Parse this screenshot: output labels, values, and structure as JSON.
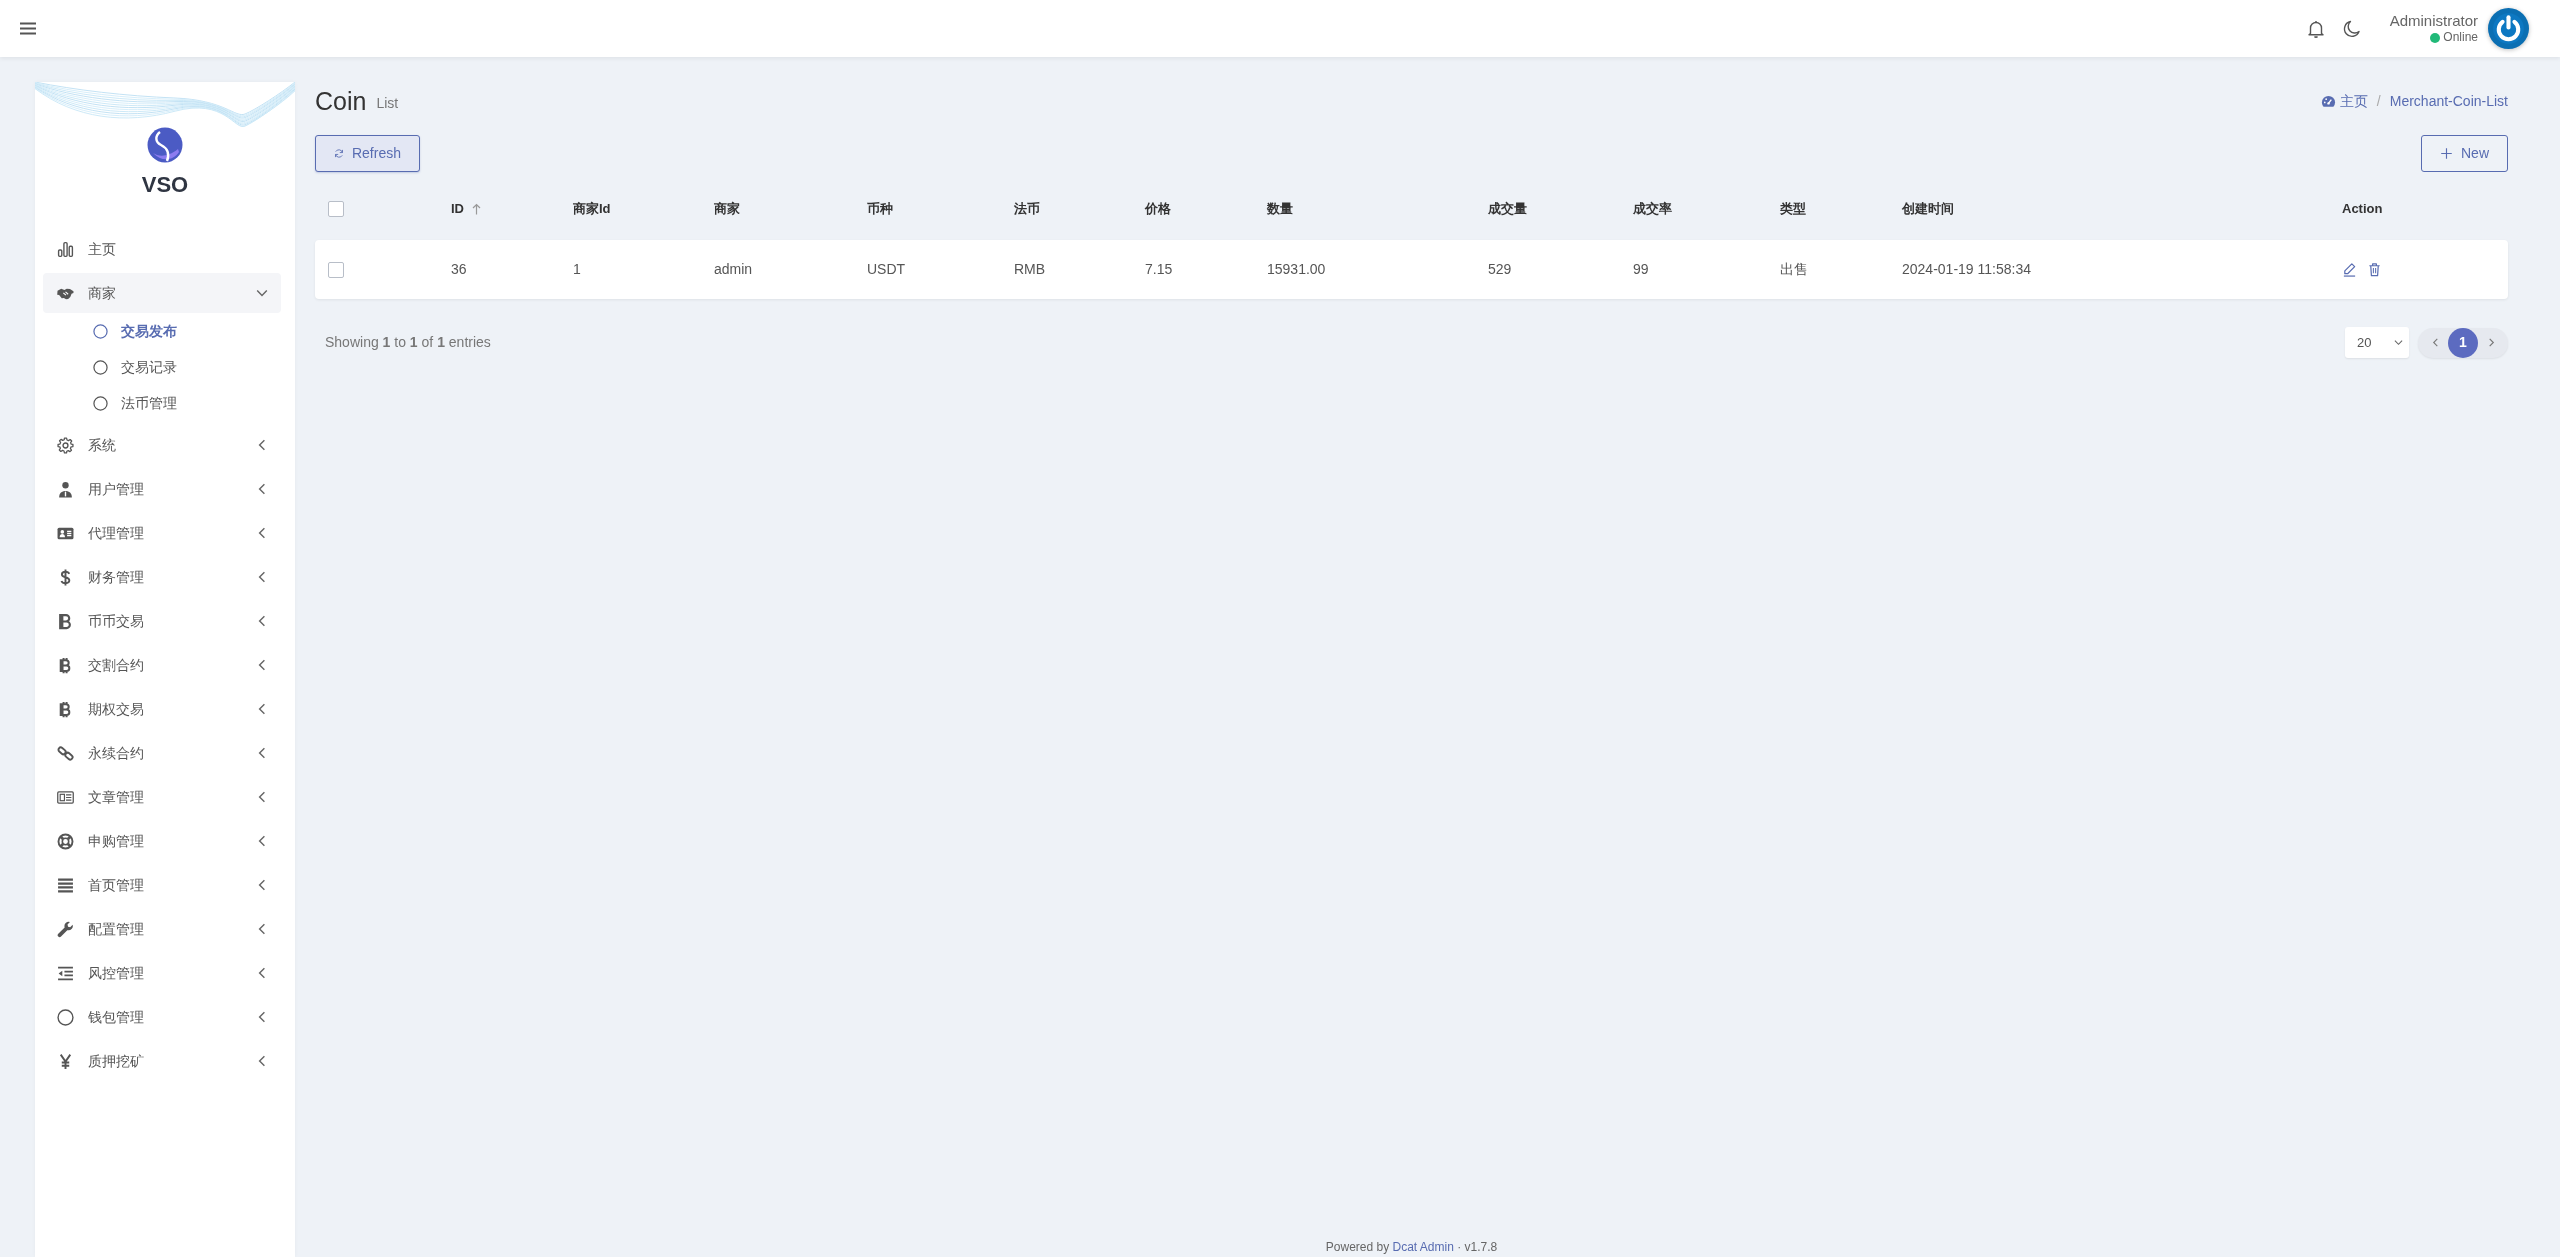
{
  "topbar": {
    "user": {
      "name": "Administrator",
      "status": "Online"
    }
  },
  "sidebar": {
    "brand": "VSO",
    "items": [
      {
        "label": "主页",
        "kind": "link",
        "selected": false
      },
      {
        "label": "商家",
        "kind": "group",
        "expanded": true,
        "selected": false,
        "children": [
          {
            "label": "交易发布",
            "selected": true
          },
          {
            "label": "交易记录",
            "selected": false
          },
          {
            "label": "法币管理",
            "selected": false
          }
        ]
      },
      {
        "label": "系统",
        "kind": "group",
        "expanded": false,
        "selected": false
      },
      {
        "label": "用户管理",
        "kind": "group",
        "expanded": false,
        "selected": false
      },
      {
        "label": "代理管理",
        "kind": "group",
        "expanded": false,
        "selected": false
      },
      {
        "label": "财务管理",
        "kind": "group",
        "expanded": false,
        "selected": false
      },
      {
        "label": "币币交易",
        "kind": "group",
        "expanded": false,
        "selected": false
      },
      {
        "label": "交割合约",
        "kind": "group",
        "expanded": false,
        "selected": false
      },
      {
        "label": "期权交易",
        "kind": "group",
        "expanded": false,
        "selected": false
      },
      {
        "label": "永续合约",
        "kind": "group",
        "expanded": false,
        "selected": false
      },
      {
        "label": "文章管理",
        "kind": "group",
        "expanded": false,
        "selected": false
      },
      {
        "label": "申购管理",
        "kind": "group",
        "expanded": false,
        "selected": false
      },
      {
        "label": "首页管理",
        "kind": "group",
        "expanded": false,
        "selected": false
      },
      {
        "label": "配置管理",
        "kind": "group",
        "expanded": false,
        "selected": false
      },
      {
        "label": "风控管理",
        "kind": "group",
        "expanded": false,
        "selected": false
      },
      {
        "label": "钱包管理",
        "kind": "group",
        "expanded": false,
        "selected": false
      },
      {
        "label": "质押挖矿",
        "kind": "group",
        "expanded": false,
        "selected": false
      }
    ]
  },
  "page": {
    "title": "Coin",
    "subtitle": "List",
    "breadcrumb": {
      "items": [
        "主页",
        "Merchant-Coin-List"
      ],
      "separator": "/"
    }
  },
  "toolbar": {
    "buttons": [
      {
        "label": "Refresh",
        "kind": "refresh"
      },
      {
        "label": "New",
        "kind": "create"
      }
    ]
  },
  "table": {
    "select_all": {
      "checked": false
    },
    "columns": [
      {
        "label": "ID",
        "sortable": true
      },
      {
        "label": "商家Id",
        "sortable": false
      },
      {
        "label": "商家",
        "sortable": false
      },
      {
        "label": "币种",
        "sortable": false
      },
      {
        "label": "法币",
        "sortable": false
      },
      {
        "label": "价格",
        "sortable": false
      },
      {
        "label": "数量",
        "sortable": false
      },
      {
        "label": "成交量",
        "sortable": false
      },
      {
        "label": "成交率",
        "sortable": false
      },
      {
        "label": "类型",
        "sortable": false
      },
      {
        "label": "创建时间",
        "sortable": false
      },
      {
        "label": "Action",
        "sortable": false
      }
    ],
    "rows": [
      {
        "checked": false,
        "cells": [
          "36",
          "1",
          "admin",
          "USDT",
          "RMB",
          "7.15",
          "15931.00",
          "529",
          "99",
          "出售",
          "2024-01-19 11:58:34"
        ]
      }
    ]
  },
  "summary": "Showing **1** to **1** of **1** entries",
  "pagination": {
    "per_page": "20",
    "pages": [
      {
        "label": "1",
        "selected": true
      }
    ]
  },
  "footer": {
    "prefix": "Powered by",
    "link": "Dcat Admin",
    "separator": "·",
    "version": "v1.7.8"
  }
}
